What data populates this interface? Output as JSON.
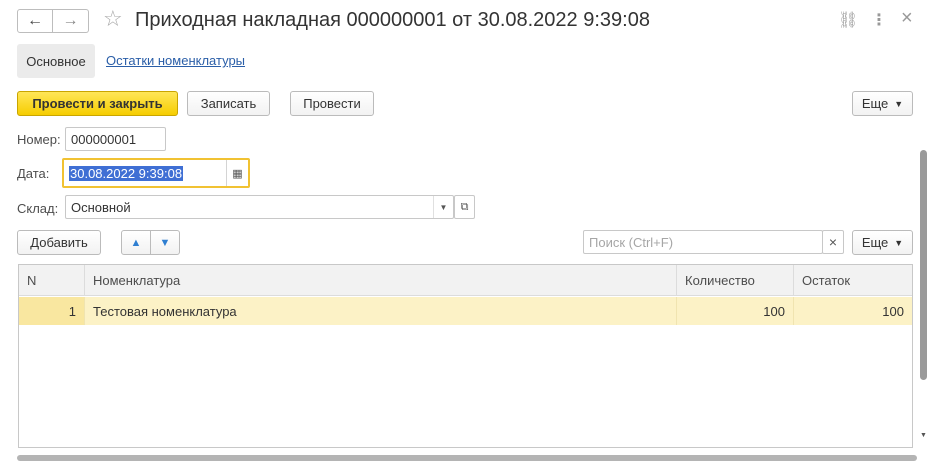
{
  "header": {
    "title": "Приходная накладная 000000001 от 30.08.2022 9:39:08",
    "back_icon": "←",
    "forward_icon": "→",
    "star_icon": "☆",
    "link_icon": "⛓",
    "more_icon": "⋮",
    "close_icon": "×"
  },
  "tabs": {
    "main": "Основное",
    "link": "Остатки номенклатуры"
  },
  "toolbar": {
    "post_close": "Провести и закрыть",
    "save": "Записать",
    "post": "Провести",
    "more": "Еще"
  },
  "form": {
    "number_label": "Номер:",
    "number_value": "000000001",
    "date_label": "Дата:",
    "date_value": "30.08.2022  9:39:08",
    "warehouse_label": "Склад:",
    "warehouse_value": "Основной"
  },
  "table_toolbar": {
    "add": "Добавить",
    "up_icon": "▲",
    "down_icon": "▼",
    "search_placeholder": "Поиск (Ctrl+F)",
    "clear_icon": "×",
    "more": "Еще"
  },
  "table": {
    "columns": [
      "N",
      "Номенклатура",
      "Количество",
      "Остаток"
    ],
    "rows": [
      {
        "n": "1",
        "item": "Тестовая номенклатура",
        "qty": "100",
        "rest": "100"
      }
    ]
  },
  "colors": {
    "primary_button": "#f6cd00",
    "date_focus_border": "#f1c232",
    "selected_row": "#fcf2c6",
    "link": "#2a5ea8"
  }
}
